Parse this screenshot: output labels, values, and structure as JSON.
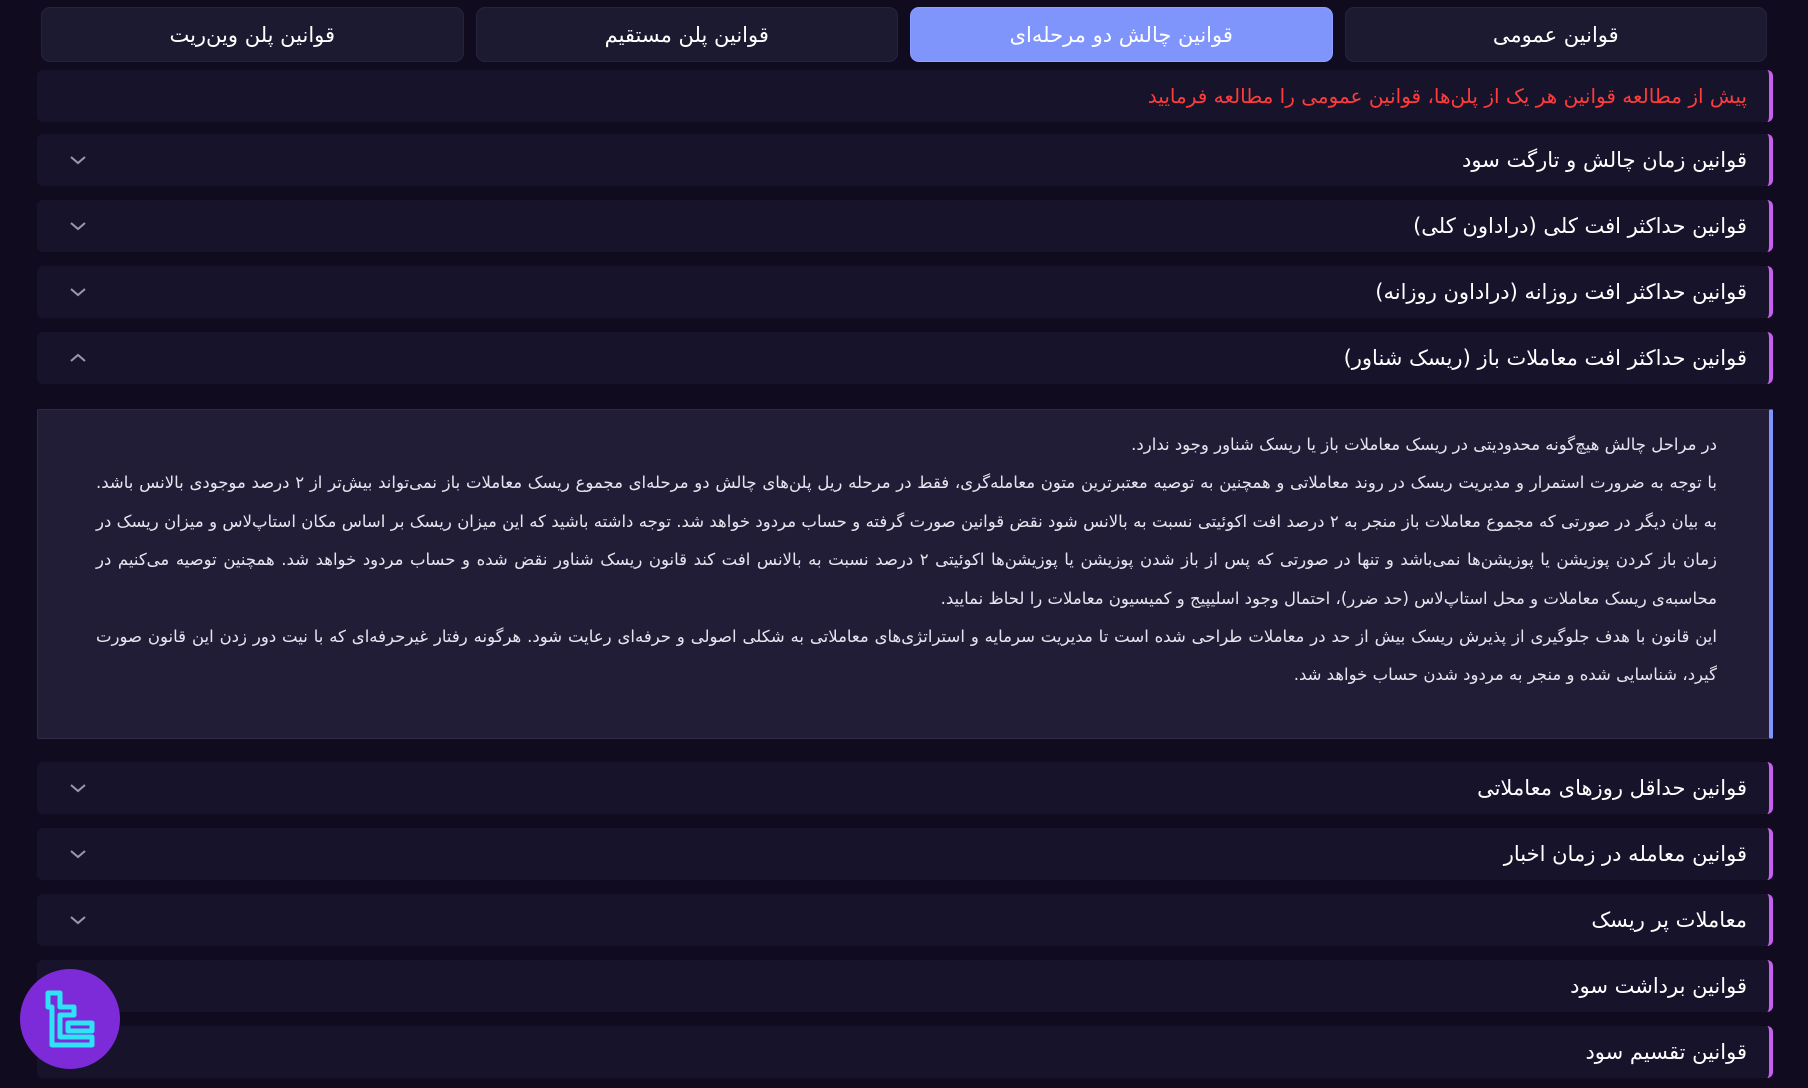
{
  "tabs": [
    {
      "label": "قوانین عمومی",
      "active": false
    },
    {
      "label": "قوانین چالش دو مرحله‌ای",
      "active": true
    },
    {
      "label": "قوانین پلن مستقیم",
      "active": false
    },
    {
      "label": "قوانین پلن وین‌ریت",
      "active": false
    }
  ],
  "notice": "پیش از مطالعه قوانین هر یک از پلن‌ها، قوانین عمومی را مطالعه فرمایید",
  "sections": [
    {
      "label": "قوانین زمان چالش و تارگت سود",
      "expanded": false,
      "icon": "chevron-down-icon"
    },
    {
      "label": "قوانین حداکثر افت کلی (دراداون کلی)",
      "expanded": false,
      "icon": "chevron-down-icon"
    },
    {
      "label": "قوانین حداکثر افت روزانه (دراداون روزانه)",
      "expanded": false,
      "icon": "chevron-down-icon"
    },
    {
      "label": "قوانین حداکثر افت معاملات باز (ریسک شناور)",
      "expanded": true,
      "icon": "chevron-up-icon"
    },
    {
      "label": "قوانین حداقل روزهای معاملاتی",
      "expanded": false,
      "icon": "chevron-down-icon"
    },
    {
      "label": "قوانین معامله در زمان اخبار",
      "expanded": false,
      "icon": "chevron-down-icon"
    },
    {
      "label": "معاملات پر ریسک",
      "expanded": false,
      "icon": "chevron-down-icon"
    },
    {
      "label": "قوانین برداشت سود",
      "expanded": false,
      "icon": "chevron-down-icon"
    },
    {
      "label": "قوانین تقسیم سود",
      "expanded": false,
      "icon": "chevron-down-icon"
    }
  ],
  "expanded_content": {
    "paragraphs": [
      "در مراحل چالش هیچ‌گونه محدودیتی در ریسک معاملات باز یا ریسک شناور وجود ندارد.",
      "با توجه به ضرورت استمرار و مدیریت ریسک در روند معاملاتی و همچنین به توصیه معتبرترین متون معامله‌گری، فقط در مرحله ریل پلن‌های چالش دو مرحله‌ای مجموع ریسک معاملات باز نمی‌تواند بیش‌تر از ۲ درصد موجودی بالانس باشد. به بیان دیگر در صورتی که مجموع معاملات باز منجر به ۲ درصد افت اکوئیتی نسبت به بالانس شود نقض قوانین صورت گرفته و حساب مردود خواهد شد. توجه داشته باشید که این میزان ریسک بر اساس مکان استاپ‌لاس و میزان ریسک در زمان باز کردن پوزیشن یا پوزیشن‌ها نمی‌باشد و تنها در صورتی که پس از باز شدن پوزیشن یا پوزیشن‌ها اکوئیتی ۲ درصد نسبت به بالانس افت کند قانون ریسک شناور نقض شده و حساب مردود خواهد شد. همچنین توصیه می‌کنیم در محاسبه‌ی ریسک معاملات و محل استاپ‌لاس (حد ضرر)، احتمال وجود اسلیپیج و کمیسیون معاملات را لحاظ نمایید.",
      "این قانون با هدف جلوگیری از پذیرش ریسک بیش از حد در معاملات طراحی شده است تا مدیریت سرمایه و استراتژی‌های معاملاتی به شکلی اصولی و حرفه‌ای رعایت شود. هرگونه رفتار غیرحرفه‌ای که با نیت دور زدن این قانون صورت گیرد، شناسایی شده و منجر به مردود شدن حساب خواهد شد."
    ]
  },
  "colors": {
    "background": "#100b1f",
    "tab_active": "#7f95fc",
    "accent_border": "#c85ff0",
    "notice_text": "#ff3c3c",
    "logo_bg": "#7d2bd8",
    "logo_fg": "#2ee3f5"
  },
  "logo_icon": "brand-logo-icon"
}
